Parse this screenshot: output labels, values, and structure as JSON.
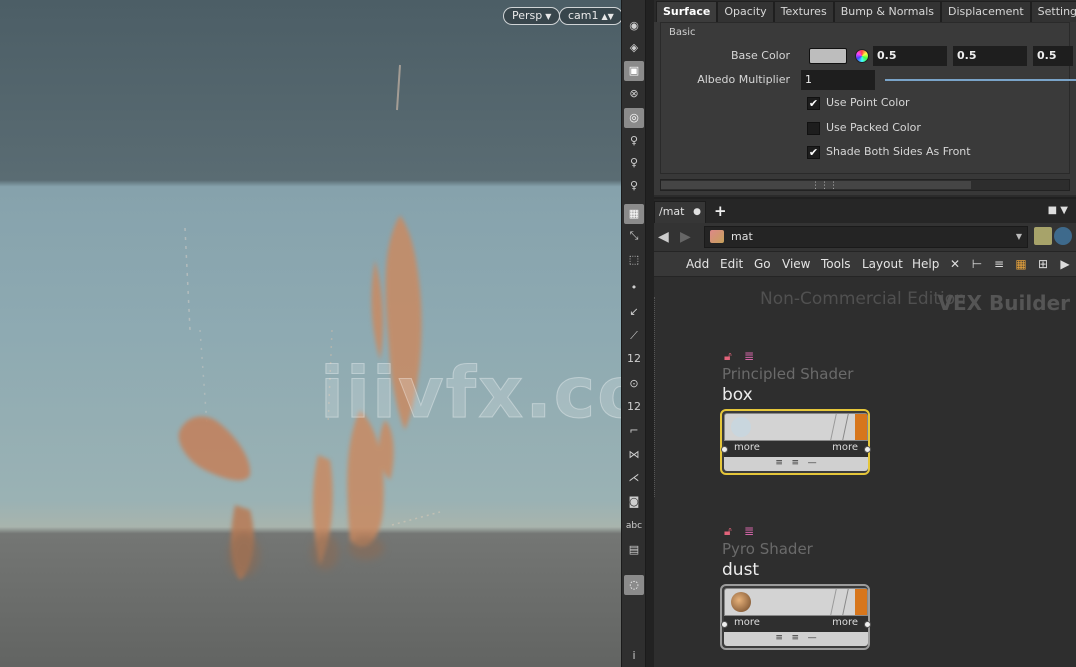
{
  "viewport": {
    "persp_label": "Persp",
    "camera_label": "cam1",
    "watermark": "iiivfx.com"
  },
  "shelf": {
    "tools": [
      "eye-icon",
      "geometry-icon",
      "lock-icon",
      "no-icon",
      "camera-snap-icon",
      "light-icon",
      "light-icon-2",
      "light-icon-3",
      "select-icon",
      "transform-icon",
      "handle-icon",
      "point-icon",
      "edge-icon",
      "brush-icon",
      "count-icon",
      "zoom-icon",
      "count-icon-2",
      "corner-icon",
      "grid-icon",
      "pose-icon",
      "display-icon",
      "abc-icon",
      "stack-icon",
      "snap-icon",
      "info-icon"
    ],
    "text_labels": {
      "count1": "12",
      "count2": "12",
      "abc": "abc",
      "info": "i"
    }
  },
  "params": {
    "tabs": [
      "Surface",
      "Opacity",
      "Textures",
      "Bump & Normals",
      "Displacement",
      "Settings"
    ],
    "active_tab": "Surface",
    "group_label": "Basic",
    "base_color_label": "Base Color",
    "base_color_values": [
      "0.5",
      "0.5",
      "0.5"
    ],
    "albedo_label": "Albedo Multiplier",
    "albedo_value": "1",
    "checkboxes": [
      {
        "label": "Use Point Color",
        "checked": true,
        "mark": "✔"
      },
      {
        "label": "Use Packed Color",
        "checked": false,
        "mark": ""
      },
      {
        "label": "Shade Both Sides As Front",
        "checked": true,
        "mark": "✔"
      }
    ]
  },
  "network": {
    "tab_label": "/mat",
    "path_value": "mat",
    "menus": [
      "Add",
      "Edit",
      "Go",
      "View",
      "Tools",
      "Layout",
      "Help"
    ],
    "context_watermark": "Non-Commercial Edition",
    "context_name": "VEX Builder",
    "nodes": [
      {
        "type": "Principled Shader",
        "name": "box",
        "in_label": "more",
        "out_label": "more",
        "selected": true
      },
      {
        "type": "Pyro Shader",
        "name": "dust",
        "in_label": "more",
        "out_label": "more",
        "selected": false
      }
    ]
  },
  "colors": {
    "node_selected_border": "#e5c63a",
    "node_orange": "#d7761c",
    "particle": "#c8875e",
    "lock": "#e3647b"
  }
}
